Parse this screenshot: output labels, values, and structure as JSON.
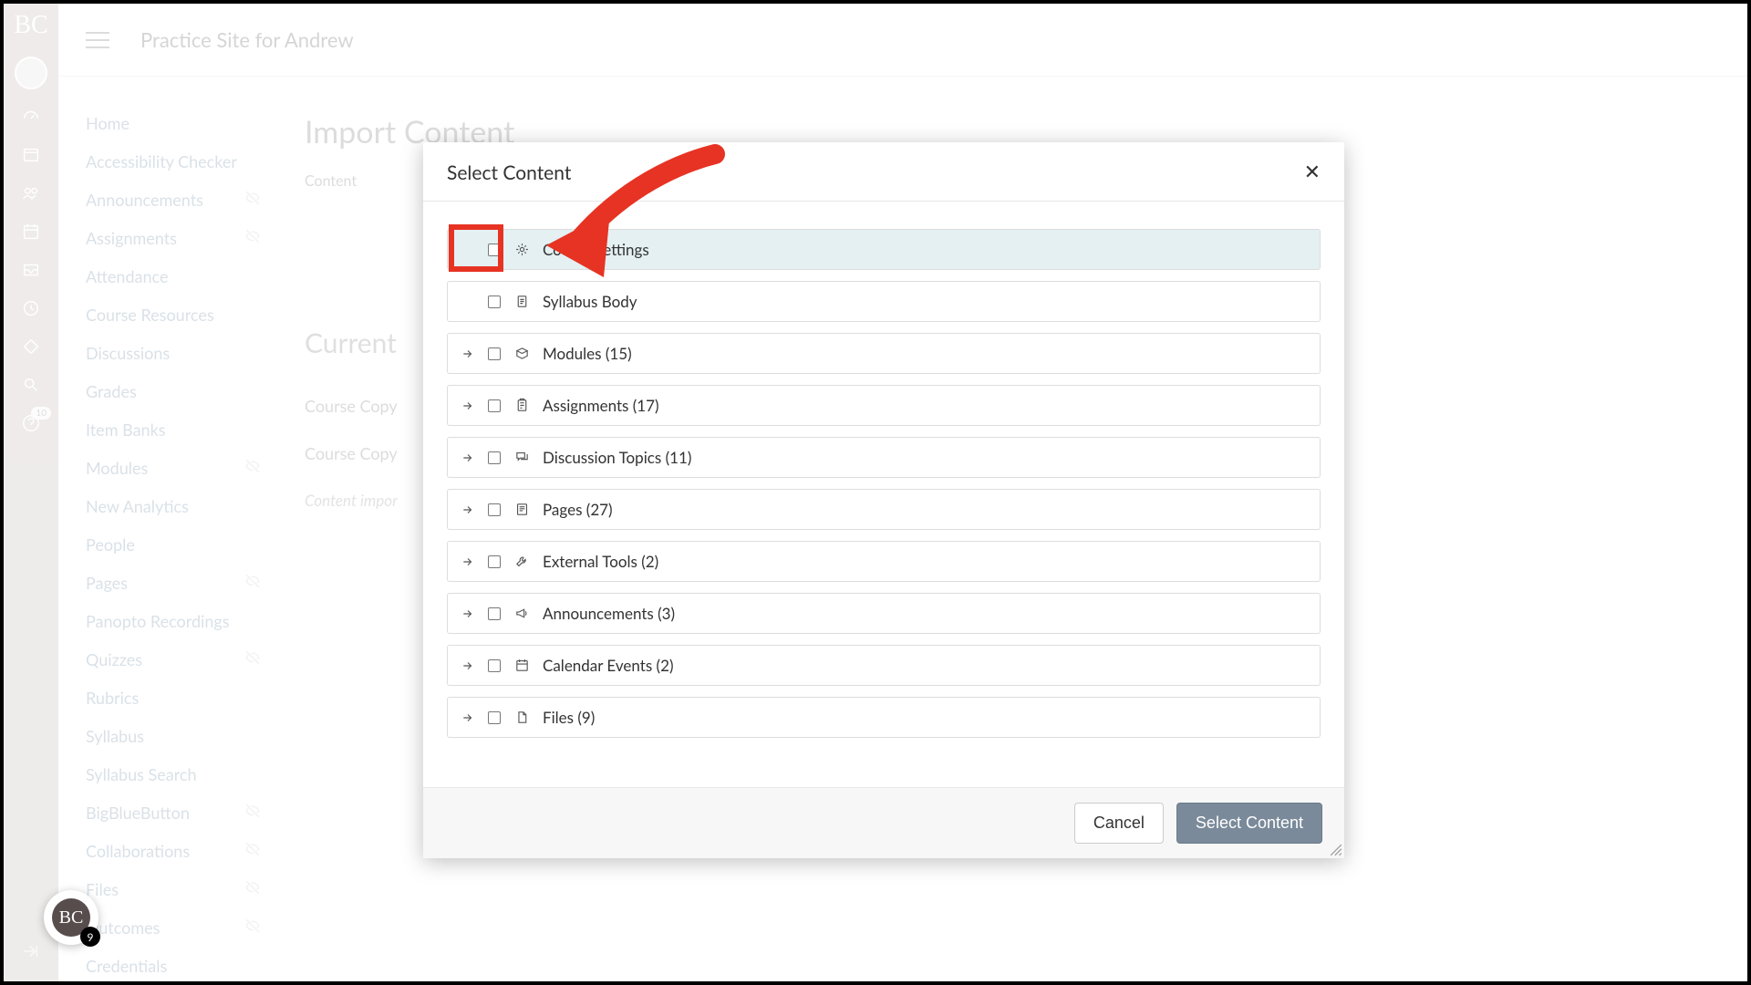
{
  "rail": {
    "logo": "BC",
    "badge_count": "10",
    "float_logo": "BC",
    "float_count": "9"
  },
  "header": {
    "title": "Practice Site for Andrew"
  },
  "nav": {
    "items": [
      {
        "label": "Home",
        "hidden": false
      },
      {
        "label": "Accessibility Checker",
        "hidden": false
      },
      {
        "label": "Announcements",
        "hidden": true
      },
      {
        "label": "Assignments",
        "hidden": true
      },
      {
        "label": "Attendance",
        "hidden": false
      },
      {
        "label": "Course Resources",
        "hidden": false
      },
      {
        "label": "Discussions",
        "hidden": false
      },
      {
        "label": "Grades",
        "hidden": false
      },
      {
        "label": "Item Banks",
        "hidden": false
      },
      {
        "label": "Modules",
        "hidden": true
      },
      {
        "label": "New Analytics",
        "hidden": false
      },
      {
        "label": "People",
        "hidden": false
      },
      {
        "label": "Pages",
        "hidden": true
      },
      {
        "label": "Panopto Recordings",
        "hidden": false
      },
      {
        "label": "Quizzes",
        "hidden": true
      },
      {
        "label": "Rubrics",
        "hidden": false
      },
      {
        "label": "Syllabus",
        "hidden": false
      },
      {
        "label": "Syllabus Search",
        "hidden": false
      },
      {
        "label": "BigBlueButton",
        "hidden": true
      },
      {
        "label": "Collaborations",
        "hidden": true
      },
      {
        "label": "Files",
        "hidden": true
      },
      {
        "label": "Outcomes",
        "hidden": true
      },
      {
        "label": "Credentials",
        "hidden": false
      }
    ]
  },
  "main": {
    "heading": "Import Content",
    "label1": "Content",
    "heading2": "Current",
    "row1": "Course Copy",
    "row2": "Course Copy",
    "note": "Content impor"
  },
  "modal": {
    "title": "Select Content",
    "items": [
      {
        "label": "Course Settings",
        "expandable": false,
        "highlight": true,
        "icon": "gear"
      },
      {
        "label": "Syllabus Body",
        "expandable": false,
        "highlight": false,
        "icon": "doc"
      },
      {
        "label": "Modules (15)",
        "expandable": true,
        "highlight": false,
        "icon": "module"
      },
      {
        "label": "Assignments (17)",
        "expandable": true,
        "highlight": false,
        "icon": "assign"
      },
      {
        "label": "Discussion Topics (11)",
        "expandable": true,
        "highlight": false,
        "icon": "discuss"
      },
      {
        "label": "Pages (27)",
        "expandable": true,
        "highlight": false,
        "icon": "page"
      },
      {
        "label": "External Tools (2)",
        "expandable": true,
        "highlight": false,
        "icon": "tool"
      },
      {
        "label": "Announcements (3)",
        "expandable": true,
        "highlight": false,
        "icon": "announce"
      },
      {
        "label": "Calendar Events (2)",
        "expandable": true,
        "highlight": false,
        "icon": "calendar"
      },
      {
        "label": "Files (9)",
        "expandable": true,
        "highlight": false,
        "icon": "file"
      }
    ],
    "cancel": "Cancel",
    "submit": "Select Content"
  }
}
